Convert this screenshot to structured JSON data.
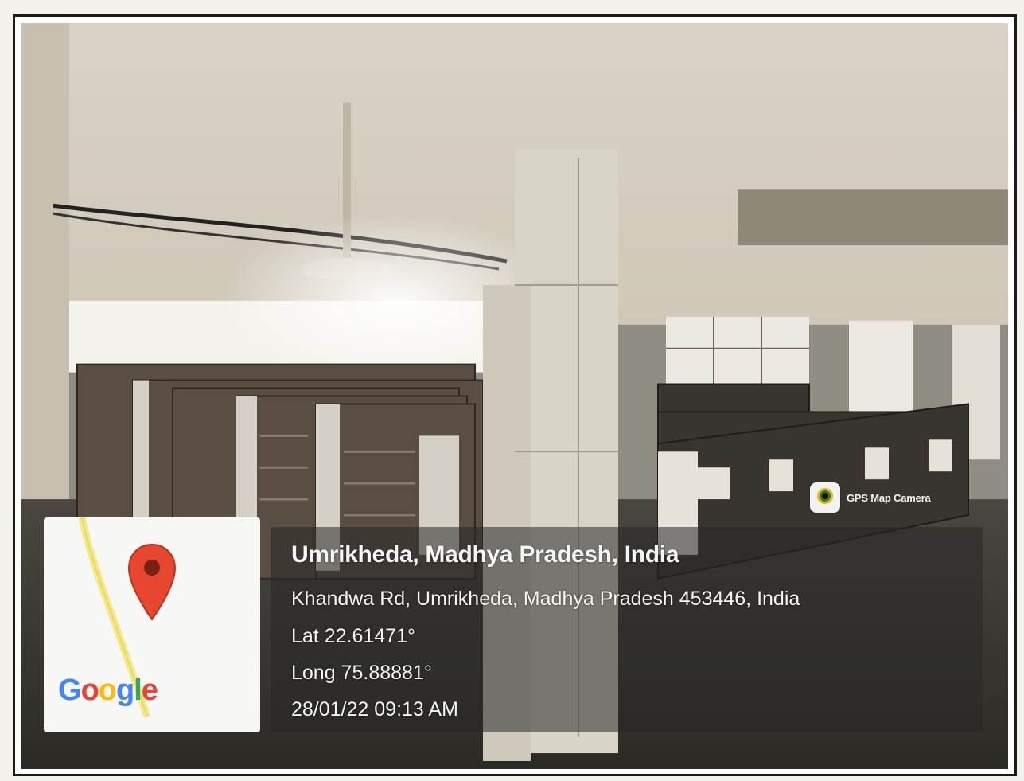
{
  "gps_badge": {
    "app_name": "GPS Map Camera",
    "icon": "gps-camera-icon"
  },
  "map": {
    "logo_text": [
      "G",
      "o",
      "o",
      "g",
      "l",
      "e"
    ],
    "pin_icon": "map-pin-icon",
    "pin_color": "#e8472f"
  },
  "location": {
    "title": "Umrikheda, Madhya Pradesh, India",
    "address": "Khandwa Rd, Umrikheda, Madhya Pradesh 453446, India",
    "latitude": "Lat 22.61471°",
    "longitude": "Long 75.88881°",
    "datetime": "28/01/22 09:13 AM"
  }
}
